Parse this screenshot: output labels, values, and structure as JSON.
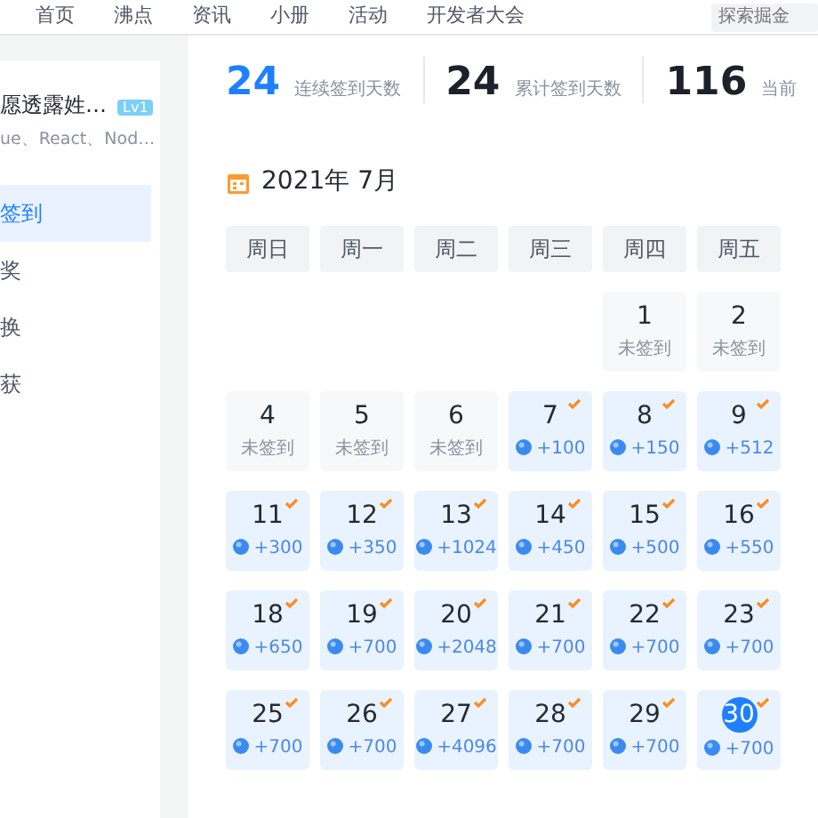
{
  "nav": {
    "items": [
      "首页",
      "沸点",
      "资讯",
      "小册",
      "活动",
      "开发者大会"
    ],
    "search": {
      "placeholder": "探索掘金"
    }
  },
  "profile": {
    "name": "愿透露姓…",
    "level": "Lv1",
    "tags": "ue、React、Nod…"
  },
  "menu": [
    {
      "label": "签到",
      "selected": true
    },
    {
      "label": "奖",
      "selected": false
    },
    {
      "label": "换",
      "selected": false
    },
    {
      "label": "获",
      "selected": false
    }
  ],
  "stats": [
    {
      "value": "24",
      "label": "连续签到天数",
      "highlight": true
    },
    {
      "value": "24",
      "label": "累计签到天数",
      "highlight": false
    },
    {
      "value": "116",
      "label": "当前",
      "highlight": false
    }
  ],
  "calendar": {
    "title": "2021年 7月",
    "weekdays": [
      "周日",
      "周一",
      "周二",
      "周三",
      "周四",
      "周五"
    ],
    "days": [
      {
        "kind": "blank"
      },
      {
        "kind": "blank"
      },
      {
        "kind": "blank"
      },
      {
        "kind": "blank"
      },
      {
        "kind": "day",
        "day": "1",
        "signed": false,
        "note": "未签到"
      },
      {
        "kind": "day",
        "day": "2",
        "signed": false,
        "note": "未签到"
      },
      {
        "kind": "day",
        "day": "4",
        "signed": false,
        "note": "未签到"
      },
      {
        "kind": "day",
        "day": "5",
        "signed": false,
        "note": "未签到"
      },
      {
        "kind": "day",
        "day": "6",
        "signed": false,
        "note": "未签到"
      },
      {
        "kind": "day",
        "day": "7",
        "signed": true,
        "note": "+100"
      },
      {
        "kind": "day",
        "day": "8",
        "signed": true,
        "note": "+150"
      },
      {
        "kind": "day",
        "day": "9",
        "signed": true,
        "note": "+512"
      },
      {
        "kind": "day",
        "day": "11",
        "signed": true,
        "note": "+300"
      },
      {
        "kind": "day",
        "day": "12",
        "signed": true,
        "note": "+350"
      },
      {
        "kind": "day",
        "day": "13",
        "signed": true,
        "note": "+1024"
      },
      {
        "kind": "day",
        "day": "14",
        "signed": true,
        "note": "+450"
      },
      {
        "kind": "day",
        "day": "15",
        "signed": true,
        "note": "+500"
      },
      {
        "kind": "day",
        "day": "16",
        "signed": true,
        "note": "+550"
      },
      {
        "kind": "day",
        "day": "18",
        "signed": true,
        "note": "+650"
      },
      {
        "kind": "day",
        "day": "19",
        "signed": true,
        "note": "+700"
      },
      {
        "kind": "day",
        "day": "20",
        "signed": true,
        "note": "+2048"
      },
      {
        "kind": "day",
        "day": "21",
        "signed": true,
        "note": "+700"
      },
      {
        "kind": "day",
        "day": "22",
        "signed": true,
        "note": "+700"
      },
      {
        "kind": "day",
        "day": "23",
        "signed": true,
        "note": "+700"
      },
      {
        "kind": "day",
        "day": "25",
        "signed": true,
        "note": "+700"
      },
      {
        "kind": "day",
        "day": "26",
        "signed": true,
        "note": "+700"
      },
      {
        "kind": "day",
        "day": "27",
        "signed": true,
        "note": "+4096"
      },
      {
        "kind": "day",
        "day": "28",
        "signed": true,
        "note": "+700"
      },
      {
        "kind": "day",
        "day": "29",
        "signed": true,
        "note": "+700"
      },
      {
        "kind": "day",
        "day": "30",
        "signed": true,
        "note": "+700",
        "today": true
      }
    ]
  }
}
